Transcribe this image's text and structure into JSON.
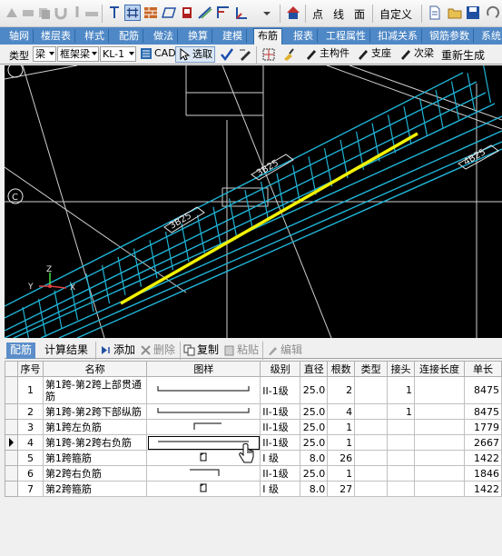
{
  "toolbar_top": {
    "labels": [
      "点",
      "线",
      "面",
      "自定义"
    ]
  },
  "menu_tabs": [
    "轴网",
    "楼层表",
    "样式",
    "配筋",
    "做法",
    "换算",
    "建模",
    "布筋",
    "报表",
    "工程属性",
    "扣减关系",
    "钢筋参数",
    "系统"
  ],
  "active_tab": "布筋",
  "toolbar_row": {
    "type_label": "类型",
    "type_value": "梁",
    "subtype_value": "框架梁",
    "member_value": "KL-1",
    "cad_label": "CAD",
    "select_label": "选取",
    "main_member_label": "主构件",
    "support_label": "支座",
    "secondary_beam_label": "次梁",
    "regenerate_label": "重新生成"
  },
  "viewport": {
    "axis_label": "C",
    "rebar_tags": [
      "3B25",
      "3B25",
      "4B25"
    ],
    "coord_labels": [
      "Z",
      "Y",
      "X"
    ],
    "colors": {
      "background": "#000000",
      "cage": "#1fb4d6",
      "highlight": "#f2f200",
      "grid": "#d0d0d0"
    }
  },
  "panel": {
    "tabs": [
      "配筋",
      "计算结果"
    ],
    "active_tab": "配筋",
    "tools": {
      "add": "添加",
      "delete": "删除",
      "copy": "复制",
      "paste": "粘贴",
      "edit": "编辑"
    },
    "columns": [
      "序号",
      "名称",
      "图样",
      "级别",
      "直径",
      "根数",
      "类型",
      "接头",
      "连接长度",
      "单长"
    ],
    "rows": [
      {
        "seq": "1",
        "name": "第1跨-第2跨上部贯通筋",
        "shape": "long-hook",
        "grade": "II-1级",
        "dia": "25.0",
        "count": "2",
        "type": "",
        "joint": "1",
        "conn": "",
        "len": "8475"
      },
      {
        "seq": "2",
        "name": "第1跨-第2跨下部纵筋",
        "shape": "long-hook",
        "grade": "II-1级",
        "dia": "25.0",
        "count": "4",
        "type": "",
        "joint": "1",
        "conn": "",
        "len": "8475"
      },
      {
        "seq": "3",
        "name": "第1跨左负筋",
        "shape": "left-hook",
        "grade": "II-1级",
        "dia": "25.0",
        "count": "1",
        "type": "",
        "joint": "",
        "conn": "",
        "len": "1779"
      },
      {
        "seq": "4",
        "name": "第1跨-第2跨右负筋",
        "shape": "long-straight",
        "grade": "II-1级",
        "dia": "25.0",
        "count": "1",
        "type": "",
        "joint": "",
        "conn": "",
        "len": "2667"
      },
      {
        "seq": "5",
        "name": "第1跨箍筋",
        "shape": "stirrup",
        "grade": "I 级",
        "dia": "8.0",
        "count": "26",
        "type": "",
        "joint": "",
        "conn": "",
        "len": "1422"
      },
      {
        "seq": "6",
        "name": "第2跨右负筋",
        "shape": "right-hook",
        "grade": "II-1级",
        "dia": "25.0",
        "count": "1",
        "type": "",
        "joint": "",
        "conn": "",
        "len": "1846"
      },
      {
        "seq": "7",
        "name": "第2跨箍筋",
        "shape": "stirrup",
        "grade": "I 级",
        "dia": "8.0",
        "count": "27",
        "type": "",
        "joint": "",
        "conn": "",
        "len": "1422"
      }
    ],
    "selected_row": "4"
  }
}
